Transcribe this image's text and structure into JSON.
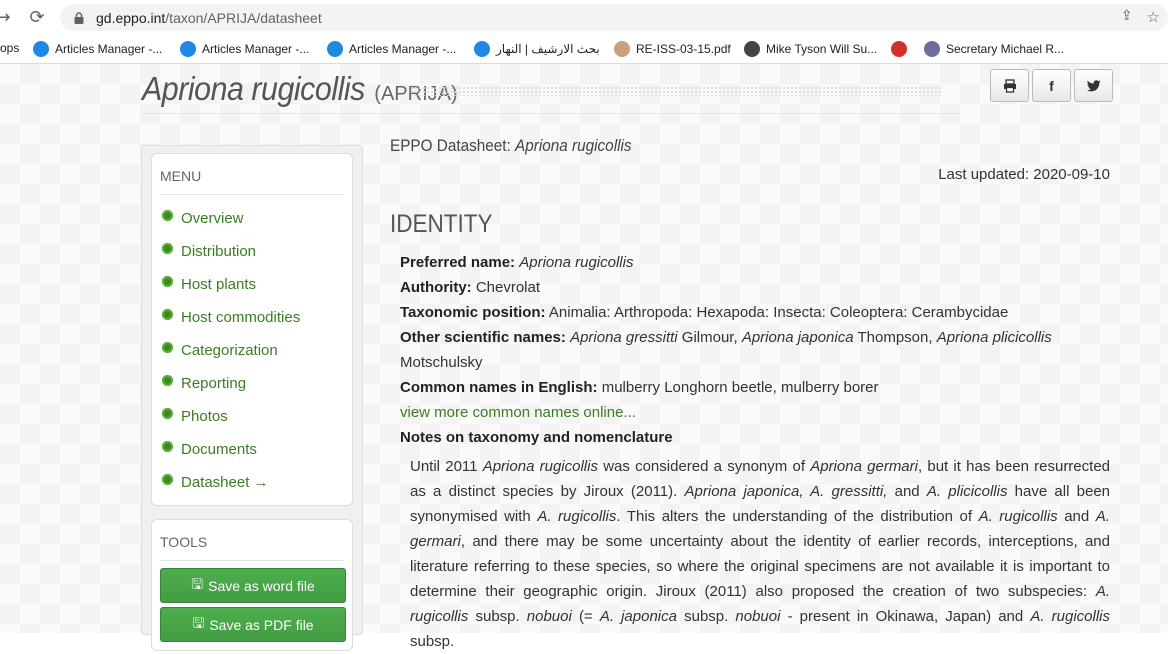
{
  "browser": {
    "url_host": "gd.eppo.int",
    "url_path": "/taxon/APRIJA/datasheet",
    "bookmarks": [
      {
        "label": "ops"
      },
      {
        "label": "Articles Manager -..."
      },
      {
        "label": "Articles Manager -..."
      },
      {
        "label": "Articles Manager -..."
      },
      {
        "label": "بحث الارشيف | النهار"
      },
      {
        "label": "RE-ISS-03-15.pdf"
      },
      {
        "label": "Mike Tyson Will Su..."
      },
      {
        "label": ""
      },
      {
        "label": "Secretary Michael R..."
      }
    ]
  },
  "header": {
    "species_name": "Apriona rugicollis",
    "eppo_code": "(APRIJA)"
  },
  "menu": {
    "title": "MENU",
    "items": [
      "Overview",
      "Distribution",
      "Host plants",
      "Host commodities",
      "Categorization",
      "Reporting",
      "Photos",
      "Documents",
      "Datasheet →"
    ]
  },
  "tools": {
    "title": "TOOLS",
    "word_btn": "Save as word file",
    "pdf_btn": "Save as PDF file"
  },
  "main": {
    "datasheet_prefix": "EPPO Datasheet:",
    "datasheet_name": "Apriona rugicollis",
    "last_updated": "Last updated: 2020-09-10",
    "section": "IDENTITY",
    "preferred_label": "Preferred name:",
    "preferred_value": "Apriona rugicollis",
    "authority_label": "Authority:",
    "authority_value": "Chevrolat",
    "taxonomic_label": "Taxonomic position:",
    "taxonomic_value": "Animalia: Arthropoda: Hexapoda: Insecta: Coleoptera: Cerambycidae",
    "other_label": "Other scientific names:",
    "other_1": "Apriona gressitti",
    "other_1_auth": "Gilmour,",
    "other_2": "Apriona japonica",
    "other_2_auth": "Thompson,",
    "other_3": "Apriona plicicollis",
    "other_3_auth": "Motschulsky",
    "common_label": "Common names in English:",
    "common_value": "mulberry Longhorn beetle, mulberry borer",
    "common_link": "view more common names online...",
    "notes_label": "Notes on taxonomy and nomenclature"
  },
  "notes": {
    "t1": "Until 2011 ",
    "i1": "Apriona rugicollis",
    "t2": " was considered a synonym of ",
    "i2": "Apriona germari",
    "t3": ", but it has been resurrected as a distinct species by Jiroux (2011). ",
    "i3": "Apriona japonica, A. gressitti,",
    "t4": " and ",
    "i4": "A. plicicollis",
    "t5": " have all been synonymised with ",
    "i5": "A. rugicollis",
    "t6": ". This alters the understanding of the distribution of ",
    "i6": "A. rugicollis",
    "t7": " and ",
    "i7": "A. germari",
    "t8": ", and there may be some uncertainty about the identity of earlier records, interceptions, and literature referring to these species, so where the original specimens are not available it is important to determine their geographic origin. Jiroux (2011) also proposed the creation of two subspecies: ",
    "i8": "A. rugicollis",
    "t9": " subsp. ",
    "i9": "nobuoi",
    "t10": " (= ",
    "i10": "A. japonica",
    "t11": " subsp. ",
    "i11": "nobuoi",
    "t12": " - present in Okinawa, Japan) and ",
    "i12": "A. rugicollis",
    "t13": " subsp."
  }
}
